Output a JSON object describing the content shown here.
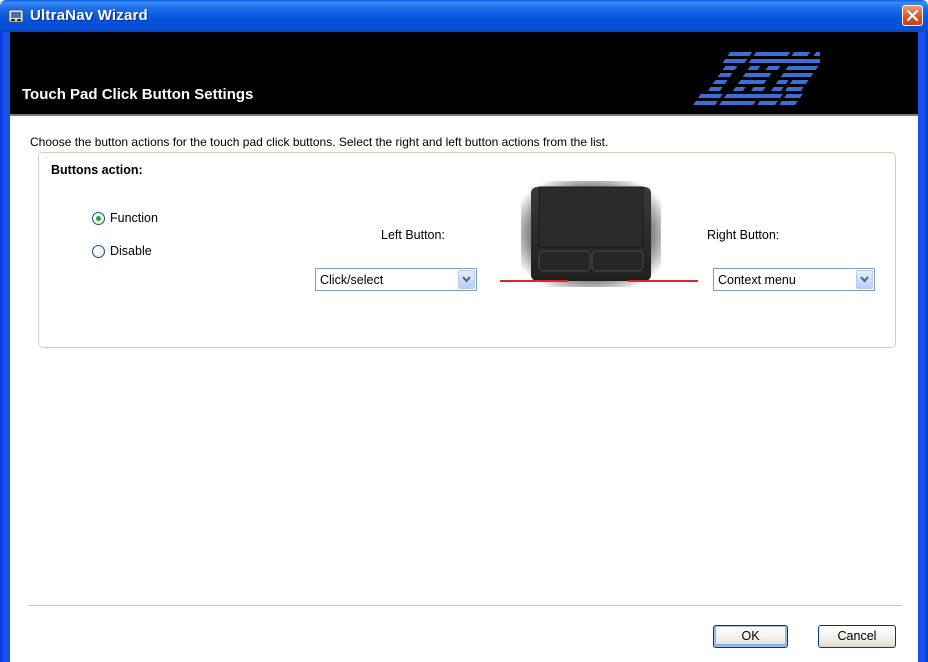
{
  "window": {
    "title": "UltraNav Wizard"
  },
  "header": {
    "title": "Touch Pad Click Button Settings",
    "logo": "IBM"
  },
  "main": {
    "instruction": "Choose the button actions for the touch pad click buttons. Select the right and left button actions from the list.",
    "group_label": "Buttons action:",
    "radios": [
      {
        "label": "Function",
        "checked": true
      },
      {
        "label": "Disable",
        "checked": false
      }
    ],
    "left_button": {
      "label": "Left Button:",
      "value": "Click/select"
    },
    "right_button": {
      "label": "Right Button:",
      "value": "Context menu"
    }
  },
  "footer": {
    "ok_label": "OK",
    "cancel_label": "Cancel"
  },
  "colors": {
    "title_bar": "#0553dd",
    "header_bg": "#000000",
    "indicator_line": "#e3232d",
    "radio_dot": "#2ba33a"
  }
}
